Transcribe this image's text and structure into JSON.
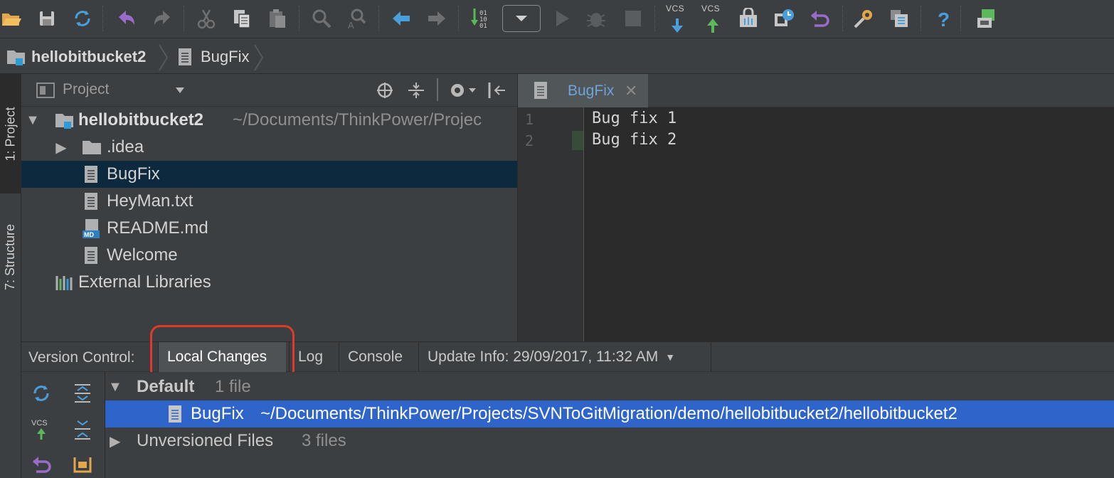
{
  "toolbar": {
    "icons": [
      "open-folder-icon",
      "save-icon",
      "sync-icon",
      "undo-icon",
      "redo-icon",
      "cut-icon",
      "copy-icon",
      "paste-icon",
      "find-icon",
      "replace-icon",
      "back-icon",
      "forward-icon",
      "make-icon",
      "run-config-dropdown",
      "run-icon",
      "debug-icon",
      "stop-icon",
      "vcs-update-icon",
      "vcs-commit-icon",
      "vcs-diff-icon",
      "vcs-history-icon",
      "vcs-revert-icon",
      "settings-icon",
      "project-structure-icon",
      "help-icon",
      "sdk-manager-icon"
    ],
    "vcs_update_label": "VCS",
    "vcs_commit_label": "VCS"
  },
  "breadcrumb": {
    "project": "hellobitbucket2",
    "file": "BugFix"
  },
  "side_tabs": {
    "project": "1: Project",
    "structure": "7: Structure"
  },
  "project_panel": {
    "title": "Project",
    "tree": {
      "root_name": "hellobitbucket2",
      "root_path": "~/Documents/ThinkPower/Projec",
      "items": [
        {
          "label": "idea_dotname",
          "text": ".idea",
          "type": "folder"
        },
        {
          "text": "BugFix",
          "type": "file"
        },
        {
          "text": "HeyMan.txt",
          "type": "file"
        },
        {
          "text": "README.md",
          "type": "markdown"
        },
        {
          "text": "Welcome",
          "type": "file"
        }
      ],
      "external": "External Libraries"
    }
  },
  "editor": {
    "tab_label": "BugFix",
    "tab_close": "✕",
    "lines": [
      {
        "number": "1",
        "text": "Bug fix 1"
      },
      {
        "number": "2",
        "text": "Bug fix 2"
      }
    ]
  },
  "version_control": {
    "label": "Version Control:",
    "tabs": [
      "Local Changes",
      "Log",
      "Console",
      "Update Info: 29/09/2017, 11:32 AM"
    ],
    "active_tab": "Local Changes"
  },
  "changes": {
    "default_label": "Default",
    "default_count": "1 file",
    "file_name": "BugFix",
    "file_path": "~/Documents/ThinkPower/Projects/SVNToGitMigration/demo/hellobitbucket2/hellobitbucket2",
    "unversioned_label": "Unversioned Files",
    "unversioned_count": "3 files",
    "vcs_label": "VCS"
  },
  "colors": {
    "selection_blue": "#2f65ca",
    "tree_selection": "#0d293e",
    "highlight_red": "#e03a2c",
    "link_blue": "#6fa3d9"
  }
}
